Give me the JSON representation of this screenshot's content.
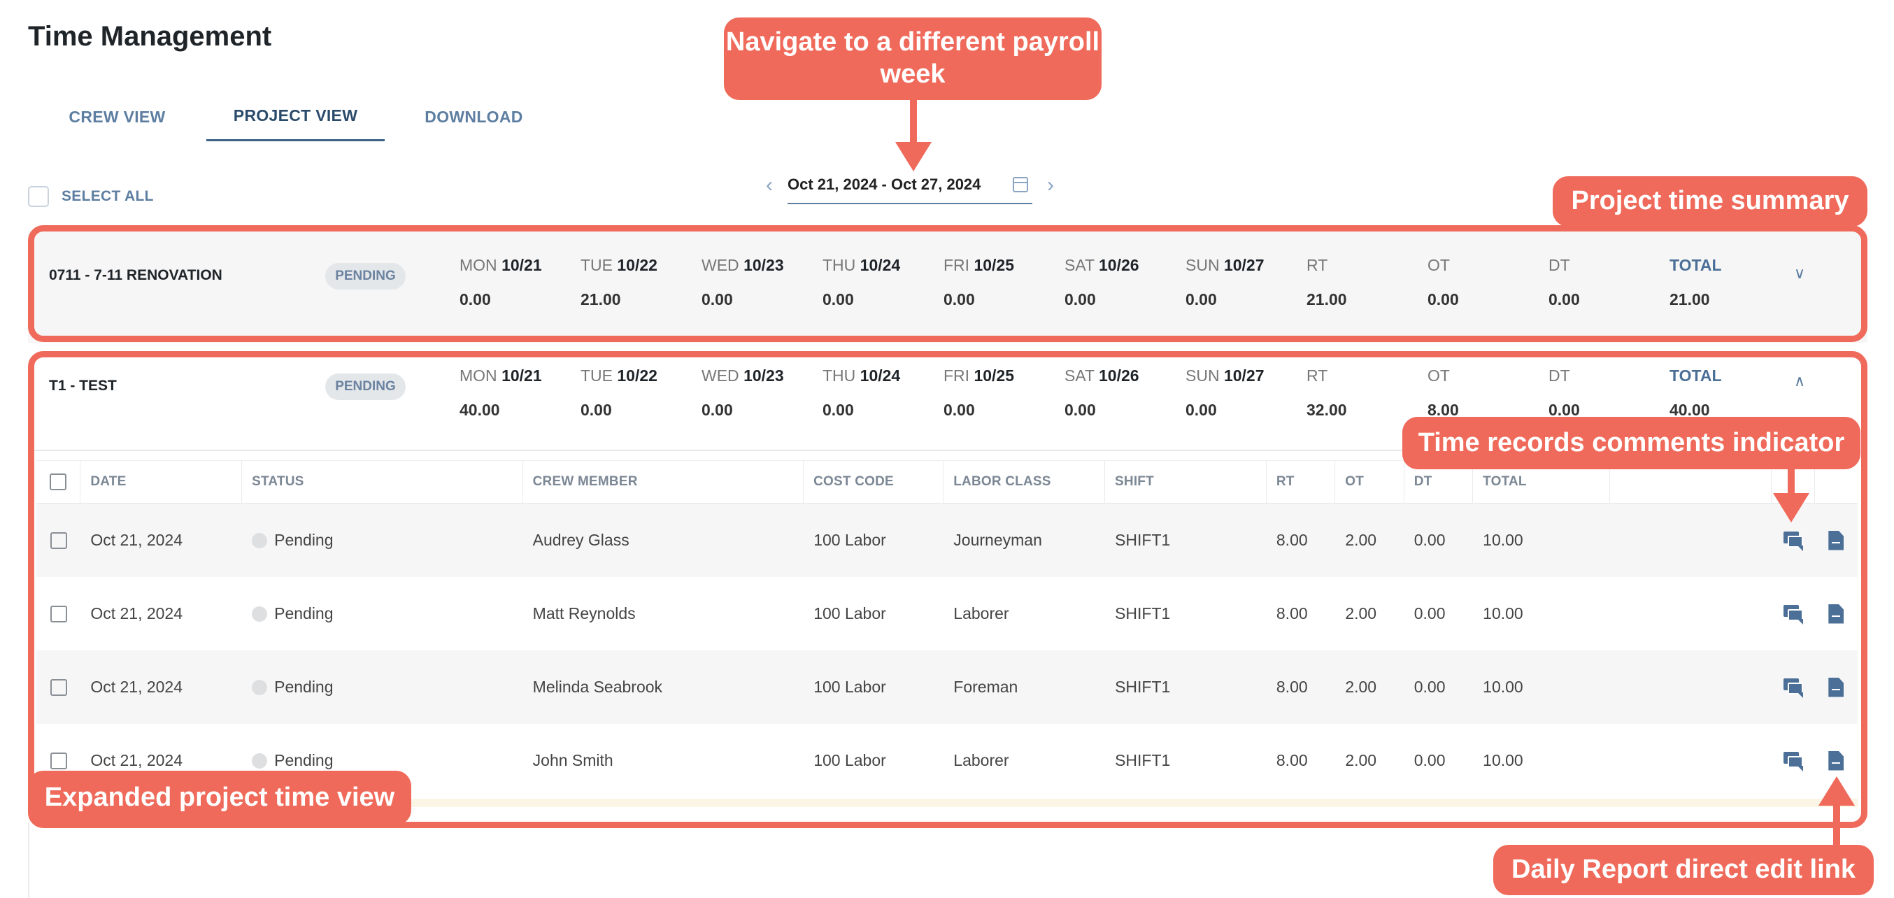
{
  "page": {
    "title": "Time Management"
  },
  "tabs": [
    {
      "label": "CREW VIEW"
    },
    {
      "label": "PROJECT VIEW"
    },
    {
      "label": "DOWNLOAD"
    }
  ],
  "date_range": "Oct 21, 2024 - Oct 27, 2024",
  "select_all_label": "SELECT ALL",
  "days": [
    {
      "dow": "MON",
      "date": "10/21"
    },
    {
      "dow": "TUE",
      "date": "10/22"
    },
    {
      "dow": "WED",
      "date": "10/23"
    },
    {
      "dow": "THU",
      "date": "10/24"
    },
    {
      "dow": "FRI",
      "date": "10/25"
    },
    {
      "dow": "SAT",
      "date": "10/26"
    },
    {
      "dow": "SUN",
      "date": "10/27"
    }
  ],
  "summary_labels": {
    "rt": "RT",
    "ot": "OT",
    "dt": "DT",
    "total": "TOTAL"
  },
  "projects": [
    {
      "name": "0711 - 7-11 RENOVATION",
      "status": "PENDING",
      "day_values": [
        "0.00",
        "21.00",
        "0.00",
        "0.00",
        "0.00",
        "0.00",
        "0.00"
      ],
      "rt": "21.00",
      "ot": "0.00",
      "dt": "0.00",
      "total": "21.00"
    },
    {
      "name": "T1 - TEST",
      "status": "PENDING",
      "day_values": [
        "40.00",
        "0.00",
        "0.00",
        "0.00",
        "0.00",
        "0.00",
        "0.00"
      ],
      "rt": "32.00",
      "ot": "8.00",
      "dt": "0.00",
      "total": "40.00"
    }
  ],
  "table": {
    "columns": [
      "DATE",
      "STATUS",
      "CREW MEMBER",
      "COST CODE",
      "LABOR CLASS",
      "SHIFT",
      "RT",
      "OT",
      "DT",
      "TOTAL"
    ],
    "rows": [
      {
        "date": "Oct 21, 2024",
        "status": "Pending",
        "crew": "Audrey Glass",
        "cost_code": "100 Labor",
        "labor_class": "Journeyman",
        "shift": "SHIFT1",
        "rt": "8.00",
        "ot": "2.00",
        "dt": "0.00",
        "total": "10.00"
      },
      {
        "date": "Oct 21, 2024",
        "status": "Pending",
        "crew": "Matt Reynolds",
        "cost_code": "100 Labor",
        "labor_class": "Laborer",
        "shift": "SHIFT1",
        "rt": "8.00",
        "ot": "2.00",
        "dt": "0.00",
        "total": "10.00"
      },
      {
        "date": "Oct 21, 2024",
        "status": "Pending",
        "crew": "Melinda Seabrook",
        "cost_code": "100 Labor",
        "labor_class": "Foreman",
        "shift": "SHIFT1",
        "rt": "8.00",
        "ot": "2.00",
        "dt": "0.00",
        "total": "10.00"
      },
      {
        "date": "Oct 21, 2024",
        "status": "Pending",
        "crew": "John Smith",
        "cost_code": "100 Labor",
        "labor_class": "Laborer",
        "shift": "SHIFT1",
        "rt": "8.00",
        "ot": "2.00",
        "dt": "0.00",
        "total": "10.00"
      }
    ]
  },
  "annotations": {
    "navigate": "Navigate to a different payroll week",
    "summary": "Project time summary",
    "comments": "Time records comments indicator",
    "expanded": "Expanded project time view",
    "daily_report": "Daily Report direct edit link"
  },
  "colors": {
    "accent": "#4b6f96",
    "annotation": "#ef6a5a",
    "badge_bg": "#e4e7ea"
  },
  "icons": {
    "prev": "chevron-left-icon",
    "next": "chevron-right-icon",
    "calendar": "calendar-icon",
    "collapse": "chevron-up-icon",
    "expand": "chevron-down-icon",
    "comment": "comment-icon",
    "report": "document-icon"
  }
}
